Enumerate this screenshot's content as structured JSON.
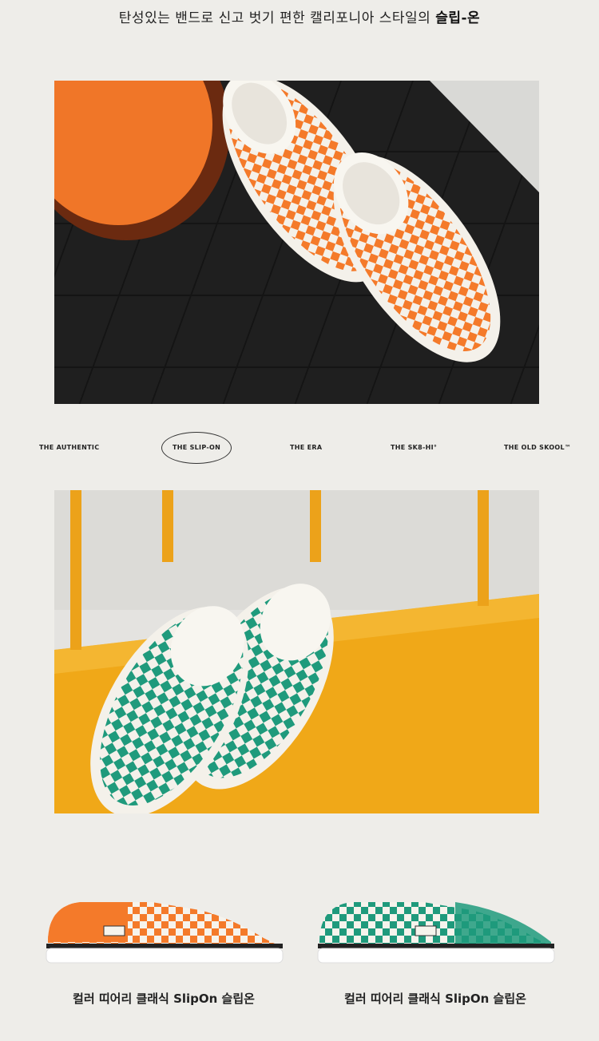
{
  "header": {
    "tagline_text": "탄성있는 밴드로 신고 벗기 편한 캘리포니아 스타일의 ",
    "tagline_bold": "슬립-온"
  },
  "nav": {
    "items": [
      "THE AUTHENTIC",
      "THE SLIP-ON",
      "THE ERA",
      "THE SK8-HI°",
      "THE OLD SKOOL™"
    ],
    "active_index": 1
  },
  "products": [
    {
      "name": "컬러 띠어리 클래식 SlipOn 슬립온",
      "color": "#f47a2a"
    },
    {
      "name": "컬러 띠어리 클래식 SlipOn 슬립온",
      "color": "#1f9a7c"
    }
  ],
  "colors": {
    "orange": "#f47a2a",
    "teal": "#1f9a7c",
    "yellow": "#f0ad1c",
    "background": "#eeede9"
  }
}
